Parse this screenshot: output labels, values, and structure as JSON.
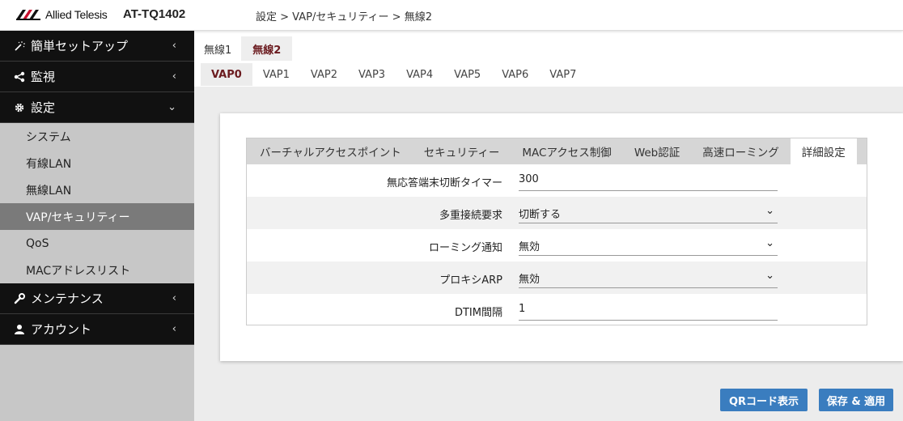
{
  "header": {
    "brand": "Allied Telesis",
    "model": "AT-TQ1402",
    "breadcrumb": "設定 > VAP/セキュリティー > 無線2"
  },
  "sidebar": {
    "sections": [
      {
        "label": "簡単セットアップ",
        "icon": "magic-wand-icon",
        "chevron": "‹"
      },
      {
        "label": "監視",
        "icon": "share-icon",
        "chevron": "‹"
      },
      {
        "label": "設定",
        "icon": "gear-icon",
        "chevron": "⌄"
      }
    ],
    "items": [
      {
        "label": "システム"
      },
      {
        "label": "有線LAN"
      },
      {
        "label": "無線LAN"
      },
      {
        "label": "VAP/セキュリティー"
      },
      {
        "label": "QoS"
      },
      {
        "label": "MACアドレスリスト"
      }
    ],
    "bottom": [
      {
        "label": "メンテナンス",
        "icon": "wrench-icon",
        "chevron": "‹"
      },
      {
        "label": "アカウント",
        "icon": "user-icon",
        "chevron": "‹"
      }
    ]
  },
  "radio_tabs": [
    "無線1",
    "無線2"
  ],
  "vap_tabs": [
    "VAP0",
    "VAP1",
    "VAP2",
    "VAP3",
    "VAP4",
    "VAP5",
    "VAP6",
    "VAP7"
  ],
  "content_tabs": [
    "バーチャルアクセスポイント",
    "セキュリティー",
    "MACアクセス制御",
    "Web認証",
    "高速ローミング",
    "詳細設定"
  ],
  "form": {
    "timer_label": "無応答端末切断タイマー",
    "timer_value": "300",
    "multi_label": "多重接続要求",
    "multi_value": "切断する",
    "roaming_label": "ローミング通知",
    "roaming_value": "無効",
    "proxy_label": "プロキシARP",
    "proxy_value": "無効",
    "dtim_label": "DTIM間隔",
    "dtim_value": "1"
  },
  "buttons": {
    "qr": "QRコード表示",
    "save": "保存 & 適用"
  },
  "colors": {
    "accent": "#6b1b1f",
    "button": "#3a7dbf",
    "nav_dark": "#111111",
    "nav_active": "#7a7a7a"
  }
}
